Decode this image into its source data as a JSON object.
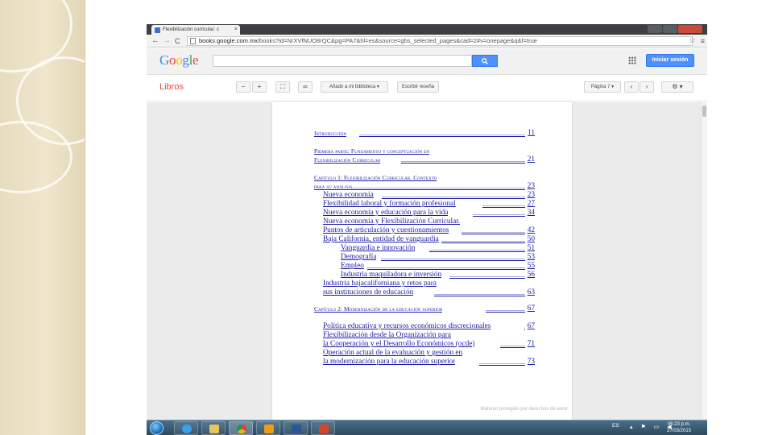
{
  "browser": {
    "tab_title": "Flexibilización curricular: c",
    "tab_close": "×",
    "url_host": "books.google.com.mx",
    "url_path": "/books?id=NrXVfNUO8rQC&pg=PA7&hl=es&source=gbs_selected_pages&cad=2#v=onepage&q&f=true",
    "nav_back": "←",
    "nav_forward": "→",
    "reload": "C",
    "star": "☆",
    "menu": "≡"
  },
  "google": {
    "logo_letters": [
      {
        "ch": "G",
        "color": "#4285f4"
      },
      {
        "ch": "o",
        "color": "#ea4335"
      },
      {
        "ch": "o",
        "color": "#fbbc05"
      },
      {
        "ch": "g",
        "color": "#4285f4"
      },
      {
        "ch": "l",
        "color": "#34a853"
      },
      {
        "ch": "e",
        "color": "#ea4335"
      }
    ],
    "search_placeholder": "",
    "search_icon": "magnifier-icon",
    "signin_label": "Iniciar sesión"
  },
  "toolbar": {
    "section": "Libros",
    "zoom_out": "−",
    "zoom_in": "+",
    "fullscreen": "⛶",
    "link": "∞",
    "add_library": "Añadir a mi biblioteca ▾",
    "write_review": "Escribir reseña",
    "page_label": "Página 7 ▾",
    "prev": "‹",
    "next": "›",
    "settings": "⚙ ▾"
  },
  "toc": [
    {
      "text": "Introducción",
      "page": "11",
      "sc": true
    },
    {
      "text": "Primera parte: Fundamento y conceptuación en",
      "page": "",
      "sc": true
    },
    {
      "text": "Flexibilización Curricular",
      "page": "21",
      "sc": true
    },
    {
      "text": "Capítulo 1: Flexibilización Curricular. Contexto",
      "page": "",
      "sc": true
    },
    {
      "text": "para su análisis",
      "page": "23",
      "sc": true
    },
    {
      "text": "Nueva economía",
      "page": "23",
      "sc": false
    },
    {
      "text": "Flexibilidad laboral y formación profesional",
      "page": "27",
      "sc": false
    },
    {
      "text": "Nueva economía y educación para la vida",
      "page": "34",
      "sc": false
    },
    {
      "text": "Nueva economía y Flexibilización Curricular.",
      "page": "",
      "sc": false
    },
    {
      "text": "Puntos de articulación y cuestionamientos",
      "page": "42",
      "sc": false
    },
    {
      "text": "Baja California, entidad de vanguardia",
      "page": "50",
      "sc": false
    },
    {
      "text": "Vanguardia e innovación",
      "page": "51",
      "sc": false
    },
    {
      "text": "Demografía",
      "page": "53",
      "sc": false
    },
    {
      "text": "Empleo",
      "page": "55",
      "sc": false
    },
    {
      "text": "Industria maquiladora e inversión",
      "page": "56",
      "sc": false
    },
    {
      "text": "Industria bajacaliforniana y retos para",
      "page": "",
      "sc": false
    },
    {
      "text": "sus instituciones de educación",
      "page": "63",
      "sc": false
    },
    {
      "text": "Capítulo 2: Modernización de la educación superior",
      "page": "67",
      "sc": true
    },
    {
      "text": "Política educativa y recursos económicos discrecionales",
      "page": "67",
      "sc": false
    },
    {
      "text": "Flexibilización desde la Organización para",
      "page": "",
      "sc": false
    },
    {
      "text": "la Cooperación y el Desarrollo Económicos (ocde)",
      "page": "71",
      "sc": false
    },
    {
      "text": "Operación actual de la evaluación y gestión en",
      "page": "",
      "sc": false
    },
    {
      "text": "la modernización para la educación superior",
      "page": "73",
      "sc": false
    }
  ],
  "copyright": "Material protegido por derechos de autor",
  "taskbar": {
    "language": "ES",
    "time": "06:23 p.m.",
    "date": "27/03/2015"
  }
}
